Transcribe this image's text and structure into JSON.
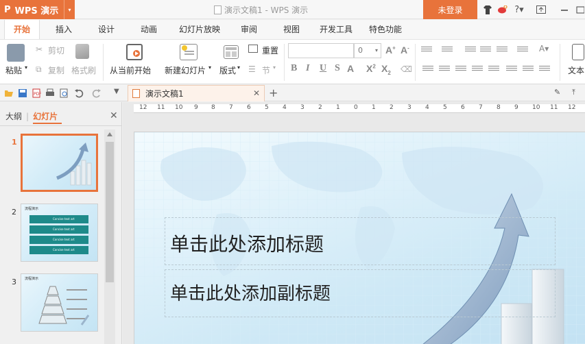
{
  "app": {
    "logo": "P",
    "name": "WPS 演示",
    "dropdown": "▾"
  },
  "window": {
    "title": "演示文稿1 - WPS 演示",
    "login": "未登录"
  },
  "titlebar_icons": [
    "shirt-icon",
    "weibo-icon",
    "help-icon",
    "window-restore-icon",
    "minimize-icon"
  ],
  "tabs": [
    {
      "label": "开始",
      "active": true
    },
    {
      "label": "插入"
    },
    {
      "label": "设计"
    },
    {
      "label": "动画"
    },
    {
      "label": "幻灯片放映"
    },
    {
      "label": "审阅"
    },
    {
      "label": "视图"
    },
    {
      "label": "开发工具"
    },
    {
      "label": "特色功能"
    }
  ],
  "ribbon": {
    "paste": "粘贴",
    "cut": "剪切",
    "copy": "复制",
    "format_painter": "格式刷",
    "from_current": "从当前开始",
    "new_slide": "新建幻灯片",
    "layout": "版式",
    "reset": "重置",
    "section": "节",
    "font_size": "0",
    "text_tool": "文本"
  },
  "doc_tab": {
    "label": "演示文稿1"
  },
  "left_panel": {
    "tab_outline": "大纲",
    "tab_slides": "幻灯片",
    "slides": [
      {
        "num": "1",
        "active": true
      },
      {
        "num": "2",
        "caption": "流程演示"
      },
      {
        "num": "3",
        "caption": "流程演示"
      }
    ],
    "slide2_rows": [
      "Concise text art",
      "Concise text art",
      "Concise text art",
      "Concise text art"
    ]
  },
  "ruler": [
    "12",
    "11",
    "10",
    "9",
    "8",
    "7",
    "6",
    "5",
    "4",
    "3",
    "2",
    "1",
    "0",
    "1",
    "2",
    "3",
    "4",
    "5",
    "6",
    "7",
    "8",
    "9",
    "10",
    "11",
    "12"
  ],
  "slide": {
    "title_placeholder": "单击此处添加标题",
    "subtitle_placeholder": "单击此处添加副标题"
  }
}
